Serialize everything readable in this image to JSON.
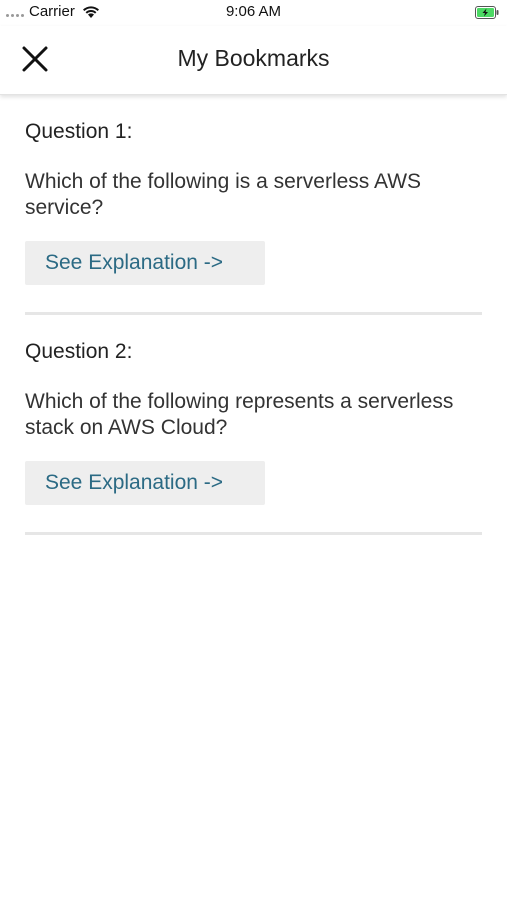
{
  "status_bar": {
    "carrier": "Carrier",
    "time": "9:06 AM"
  },
  "header": {
    "title": "My Bookmarks",
    "close_icon": "close-icon"
  },
  "questions": [
    {
      "heading": "Question 1:",
      "text": "Which of the following is a serverless AWS service?",
      "button_label": "See Explanation ->"
    },
    {
      "heading": "Question 2:",
      "text": "Which of the following represents a serverless stack on AWS Cloud?",
      "button_label": "See Explanation ->"
    }
  ],
  "colors": {
    "link_text": "#2b6a84",
    "button_bg": "#eeeeee",
    "divider": "#e6e6e6",
    "battery_fill": "#4cd964"
  }
}
